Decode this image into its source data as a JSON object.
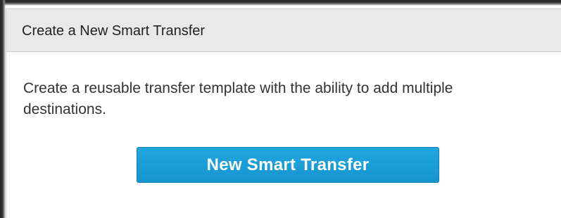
{
  "panel": {
    "title": "Create a New Smart Transfer",
    "description": "Create a reusable transfer template with the ability to add multiple destinations.",
    "button_label": "New Smart Transfer"
  },
  "colors": {
    "button_background": "#1a9ed7",
    "header_background": "#e9e9e9",
    "text": "#333333"
  }
}
